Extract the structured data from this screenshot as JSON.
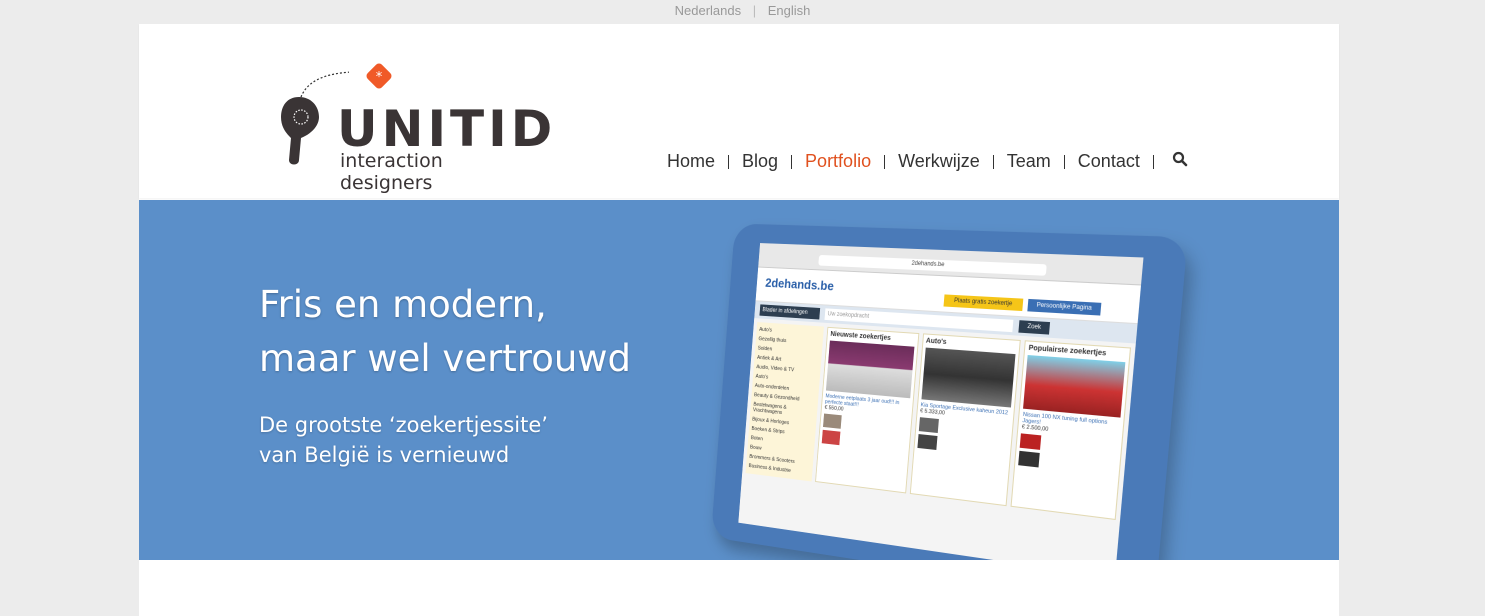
{
  "lang": {
    "nl": "Nederlands",
    "sep": "|",
    "en": "English"
  },
  "logo": {
    "wordmark": "UNITID",
    "tagline": "interaction designers",
    "accent": "#f05a28"
  },
  "nav": {
    "items": [
      {
        "label": "Home"
      },
      {
        "label": "Blog"
      },
      {
        "label": "Portfolio"
      },
      {
        "label": "Werkwijze"
      },
      {
        "label": "Team"
      },
      {
        "label": "Contact"
      }
    ],
    "active_color": "#e0511f",
    "search_icon": "search-icon"
  },
  "hero": {
    "background": "#5b8fc9",
    "headline_line1": "Fris en modern,",
    "headline_line2": "maar wel vertrouwd",
    "sub_line1": "De grootste ‘zoekertjessite’",
    "sub_line2": "van België is vernieuwd"
  },
  "tablet": {
    "url": "2dehands.be",
    "site_logo": "2dehands.be",
    "place_btn": "Plaats gratis zoekertje",
    "account_btn": "Persoonlijke Pagina",
    "category_select": "Blader in afdelingen",
    "search_placeholder": "Uw zoekopdracht",
    "search_btn": "Zoek",
    "sidebar": [
      "Auto's",
      "Gezellig thuis",
      "Solden",
      "Antiek & Art",
      "Audio, Video & TV",
      "Auto's",
      "Auto-onderdelen",
      "Beauty & Gezondheid",
      "Bestelwagens & Vrachtwagens",
      "Bijoux & Horloges",
      "Boeken & Strips",
      "Boten",
      "Bouw",
      "Brommers & Scooters",
      "Business & Industrie"
    ],
    "col1_title": "Nieuwste zoekertjes",
    "col1_ad": "Moderne eetplaats 3 jaar oud!!! in perfecte staat!!!",
    "col1_price": "€ 550,00",
    "col2_title": "Auto's",
    "col2_ad": "Kia Sportage Exclusive kaheun 2012",
    "col2_price": "€ 5.333,00",
    "col3_title": "Populairste zoekertjes",
    "col3_ad": "Nissan 100 NX tuning full options Jagers!",
    "col3_price": "€ 2.500,00"
  }
}
